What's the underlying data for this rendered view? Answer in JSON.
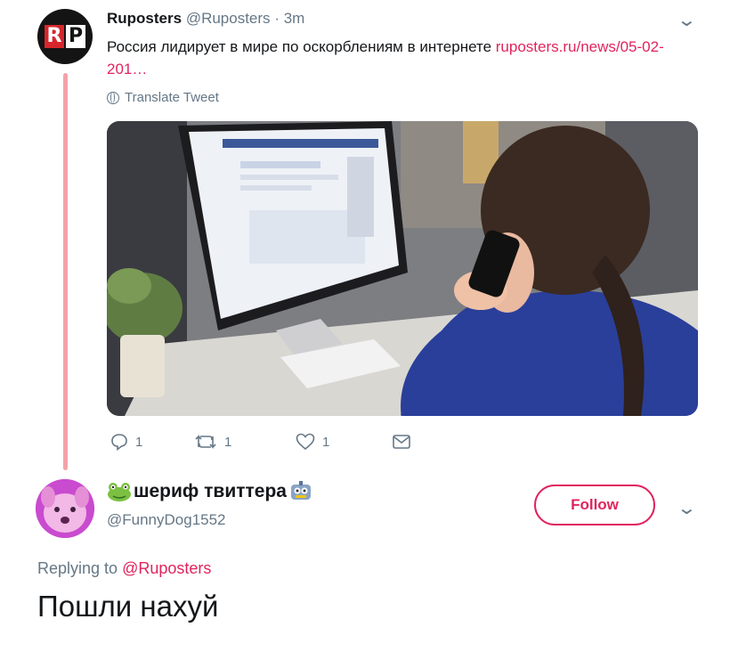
{
  "parent_tweet": {
    "author_name": "Ruposters",
    "author_handle": "@Ruposters",
    "separator": "·",
    "time": "3m",
    "text": "Россия лидирует в мире по оскорблениям в интернете ",
    "link_text": "ruposters.ru/news/05-02-201…",
    "translate_label": "Translate Tweet",
    "avatar_letters": [
      "R",
      "P"
    ],
    "counts": {
      "replies": "1",
      "retweets": "1",
      "likes": "1"
    }
  },
  "reply_tweet": {
    "author_name": "шериф твиттера",
    "author_handle": "@FunnyDog1552",
    "follow_label": "Follow",
    "replying_prefix": "Replying to ",
    "replying_to": "@Ruposters",
    "text": "Пошли нахуй"
  },
  "icons": {
    "reply": "reply-icon",
    "retweet": "retweet-icon",
    "like": "heart-icon",
    "dm": "envelope-icon",
    "more": "chevron-down-icon",
    "globe": "globe-icon"
  },
  "colors": {
    "accent": "#e0245e",
    "secondary_text": "#657786",
    "thread_line": "#f3a3a8"
  }
}
